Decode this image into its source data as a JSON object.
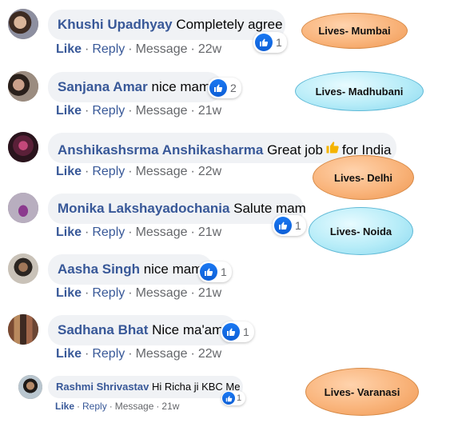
{
  "comments": [
    {
      "name": "Khushi Upadhyay",
      "text": "Completely agree",
      "likes": "1",
      "like": "Like",
      "reply": "Reply",
      "message": "Message",
      "time": "22w"
    },
    {
      "name": "Sanjana Amar",
      "text": "nice mam",
      "likes": "2",
      "like": "Like",
      "reply": "Reply",
      "message": "Message",
      "time": "21w"
    },
    {
      "name": "Anshikashsrma Anshikasharma",
      "text": "Great job",
      "text_after": "for India",
      "like": "Like",
      "reply": "Reply",
      "message": "Message",
      "time": "22w"
    },
    {
      "name": "Monika Lakshayadochania",
      "text": "Salute mam",
      "likes": "1",
      "like": "Like",
      "reply": "Reply",
      "message": "Message",
      "time": "21w"
    },
    {
      "name": "Aasha Singh",
      "text": "nice mam",
      "likes": "1",
      "like": "Like",
      "reply": "Reply",
      "message": "Message",
      "time": "21w"
    },
    {
      "name": "Sadhana Bhat",
      "text": "Nice ma'am",
      "likes": "1",
      "like": "Like",
      "reply": "Reply",
      "message": "Message",
      "time": "22w"
    },
    {
      "name": "Rashmi Shrivastav",
      "text": "Hi Richa ji KBC Me",
      "likes": "1",
      "like": "Like",
      "reply": "Reply",
      "message": "Message",
      "time": "21w"
    }
  ],
  "annotations": [
    {
      "label": "Lives- Mumbai",
      "style": "orange"
    },
    {
      "label": "Lives- Madhubani",
      "style": "cyan"
    },
    {
      "label": "Lives- Delhi",
      "style": "orange"
    },
    {
      "label": "Lives- Noida",
      "style": "cyan"
    },
    {
      "label": "Lives- Varanasi",
      "style": "orange"
    }
  ],
  "colors": {
    "name": "#385898",
    "bubble": "#f0f2f5",
    "like_blue": "#1a78f2",
    "muted": "#65676b"
  }
}
